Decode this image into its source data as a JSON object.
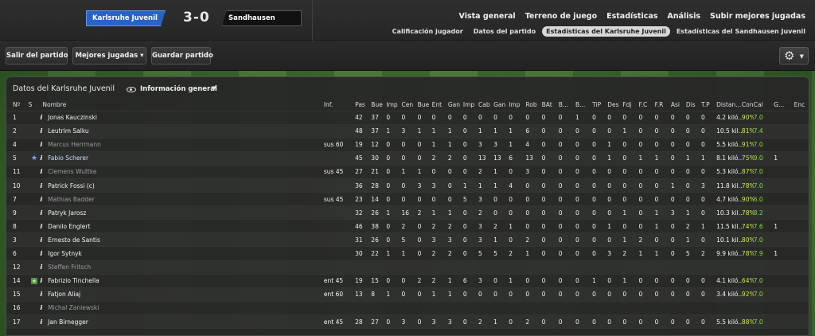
{
  "match": {
    "home_team": "Karlsruhe Juvenil",
    "score": "3-0",
    "away_team": "Sandhausen Juvenil"
  },
  "nav_top": [
    "Vista general",
    "Terreno de juego",
    "Estadísticas",
    "Análisis",
    "Subir mejores jugadas"
  ],
  "nav_sub": [
    {
      "label": "Calificación jugador",
      "active": false
    },
    {
      "label": "Datos del partido",
      "active": false
    },
    {
      "label": "Estadísticas del Karlsruhe Juvenil",
      "active": true
    },
    {
      "label": "Estadísticas del Sandhausen Juvenil",
      "active": false
    }
  ],
  "toolbar": {
    "exit_label": "Salir del partido",
    "highlights_label": "Mejores jugadas",
    "save_label": "Guardar partido"
  },
  "panel": {
    "title": "Datos del Karlsruhe Juvenil",
    "view_label": "Información general"
  },
  "columns": [
    "Nº",
    "S",
    "Nombre",
    "Inf.",
    "Pas",
    "Bue",
    "Imp",
    "Cen",
    "Bue",
    "Ent",
    "Gan",
    "Imp",
    "Cab",
    "Gan",
    "Imp",
    "Rob",
    "BAt",
    "B...",
    "B...",
    "TiP",
    "Des",
    "Fdj",
    "F.C",
    "F.R",
    "Asi",
    "Dis",
    "T.P",
    "Distan...",
    "Con",
    "Cal",
    "G...",
    "Enc"
  ],
  "players": [
    {
      "num": "1",
      "s": "",
      "name": "Jonas Kauczinski",
      "inf": "",
      "stats": [
        "42",
        "37",
        "0",
        "0",
        "0",
        "0",
        "0",
        "0",
        "0",
        "0",
        "0",
        "0",
        "0",
        "0",
        "1",
        "0",
        "0",
        "0",
        "0",
        "0",
        "0",
        "0",
        "0"
      ],
      "dist": "4.2 kiló...",
      "con": "90%",
      "cal": "7.0",
      "g": "",
      "enc": "",
      "type": "normal"
    },
    {
      "num": "2",
      "s": "",
      "name": "Leutrim Salku",
      "inf": "",
      "stats": [
        "48",
        "37",
        "1",
        "3",
        "1",
        "1",
        "1",
        "0",
        "1",
        "1",
        "1",
        "6",
        "0",
        "0",
        "0",
        "0",
        "0",
        "1",
        "0",
        "0",
        "0",
        "0",
        "0"
      ],
      "dist": "10.5 kil...",
      "con": "81%",
      "cal": "7.4",
      "g": "",
      "enc": "",
      "type": "normal"
    },
    {
      "num": "4",
      "s": "",
      "name": "Marcus Herrmann",
      "inf": "sus 60",
      "stats": [
        "19",
        "12",
        "0",
        "0",
        "0",
        "1",
        "1",
        "0",
        "3",
        "3",
        "1",
        "4",
        "0",
        "0",
        "0",
        "0",
        "1",
        "0",
        "0",
        "0",
        "0",
        "0",
        "0"
      ],
      "dist": "5.5 kiló...",
      "con": "91%",
      "cal": "7.0",
      "g": "",
      "enc": "",
      "type": "sub"
    },
    {
      "num": "5",
      "s": "star",
      "name": "Fabio Scherer",
      "inf": "",
      "stats": [
        "45",
        "30",
        "0",
        "0",
        "0",
        "2",
        "2",
        "0",
        "13",
        "13",
        "6",
        "13",
        "0",
        "0",
        "0",
        "0",
        "1",
        "0",
        "1",
        "1",
        "0",
        "1",
        "1"
      ],
      "dist": "8.1 kiló...",
      "con": "75%",
      "cal": "9.0",
      "g": "1",
      "enc": "",
      "type": "sel"
    },
    {
      "num": "11",
      "s": "",
      "name": "Clemens Wuttke",
      "inf": "sus 45",
      "stats": [
        "27",
        "21",
        "0",
        "1",
        "1",
        "0",
        "0",
        "0",
        "2",
        "1",
        "0",
        "3",
        "0",
        "0",
        "0",
        "0",
        "0",
        "0",
        "0",
        "0",
        "0",
        "0",
        "0"
      ],
      "dist": "5.3 kiló...",
      "con": "87%",
      "cal": "7.0",
      "g": "",
      "enc": "",
      "type": "sub"
    },
    {
      "num": "10",
      "s": "",
      "name": "Patrick Fossi (c)",
      "inf": "",
      "stats": [
        "36",
        "28",
        "0",
        "0",
        "3",
        "3",
        "0",
        "1",
        "1",
        "1",
        "4",
        "0",
        "0",
        "0",
        "0",
        "0",
        "0",
        "0",
        "0",
        "0",
        "1",
        "0",
        "3"
      ],
      "dist": "11.8 kil...",
      "con": "78%",
      "cal": "7.0",
      "g": "",
      "enc": "",
      "type": "normal"
    },
    {
      "num": "7",
      "s": "",
      "name": "Mathias Badder",
      "inf": "sus 45",
      "stats": [
        "23",
        "14",
        "0",
        "0",
        "0",
        "0",
        "0",
        "5",
        "3",
        "0",
        "0",
        "0",
        "0",
        "0",
        "0",
        "0",
        "0",
        "0",
        "0",
        "0",
        "0",
        "0",
        "0"
      ],
      "dist": "4.7 kiló...",
      "con": "90%",
      "cal": "6.0",
      "g": "",
      "enc": "",
      "type": "sub"
    },
    {
      "num": "9",
      "s": "",
      "name": "Patryk Jarosz",
      "inf": "",
      "stats": [
        "32",
        "26",
        "1",
        "16",
        "2",
        "1",
        "1",
        "0",
        "2",
        "0",
        "0",
        "0",
        "0",
        "0",
        "0",
        "0",
        "0",
        "1",
        "0",
        "1",
        "3",
        "1",
        "0"
      ],
      "dist": "10.3 kil...",
      "con": "78%",
      "cal": "8.2",
      "g": "",
      "enc": "",
      "type": "normal"
    },
    {
      "num": "8",
      "s": "",
      "name": "Danilo Englert",
      "inf": "",
      "stats": [
        "46",
        "38",
        "0",
        "2",
        "0",
        "2",
        "2",
        "0",
        "3",
        "2",
        "1",
        "0",
        "0",
        "0",
        "0",
        "0",
        "1",
        "0",
        "0",
        "1",
        "0",
        "2",
        "1"
      ],
      "dist": "11.5 kil...",
      "con": "74%",
      "cal": "7.6",
      "g": "1",
      "enc": "",
      "type": "normal"
    },
    {
      "num": "3",
      "s": "",
      "name": "Ernesto de Santis",
      "inf": "",
      "stats": [
        "31",
        "26",
        "0",
        "5",
        "0",
        "3",
        "3",
        "0",
        "3",
        "1",
        "0",
        "2",
        "0",
        "0",
        "0",
        "0",
        "0",
        "1",
        "2",
        "0",
        "0",
        "1",
        "0"
      ],
      "dist": "10.1 kil...",
      "con": "80%",
      "cal": "7.0",
      "g": "",
      "enc": "",
      "type": "normal"
    },
    {
      "num": "6",
      "s": "",
      "name": "Igor Sytnyk",
      "inf": "",
      "stats": [
        "30",
        "22",
        "1",
        "1",
        "0",
        "2",
        "2",
        "0",
        "5",
        "5",
        "2",
        "1",
        "0",
        "0",
        "0",
        "0",
        "3",
        "2",
        "1",
        "1",
        "0",
        "5",
        "2"
      ],
      "dist": "9.9 kiló...",
      "con": "78%",
      "cal": "7.9",
      "g": "1",
      "enc": "",
      "type": "normal"
    },
    {
      "num": "12",
      "s": "",
      "name": "Steffen Fritsch",
      "inf": "",
      "stats": [
        "",
        "",
        "",
        "",
        "",
        "",
        "",
        "",
        "",
        "",
        "",
        "",
        "",
        "",
        "",
        "",
        "",
        "",
        "",
        "",
        "",
        "",
        ""
      ],
      "dist": "",
      "con": "",
      "cal": "",
      "g": "",
      "enc": "",
      "type": "sub"
    },
    {
      "num": "14",
      "s": "plus",
      "name": "Fabrizio Tinchella",
      "inf": "ent 45",
      "stats": [
        "19",
        "15",
        "0",
        "0",
        "2",
        "2",
        "1",
        "6",
        "3",
        "0",
        "1",
        "0",
        "0",
        "0",
        "0",
        "1",
        "0",
        "1",
        "0",
        "0",
        "0",
        "0",
        "0"
      ],
      "dist": "4.1 kiló...",
      "con": "64%",
      "cal": "7.0",
      "g": "",
      "enc": "",
      "type": "normal"
    },
    {
      "num": "15",
      "s": "",
      "name": "Fatjon Aliaj",
      "inf": "ent 60",
      "stats": [
        "13",
        "8",
        "1",
        "0",
        "0",
        "1",
        "1",
        "0",
        "0",
        "0",
        "0",
        "0",
        "0",
        "0",
        "0",
        "0",
        "0",
        "0",
        "0",
        "0",
        "0",
        "0",
        "0"
      ],
      "dist": "3.4 kiló...",
      "con": "92%",
      "cal": "7.0",
      "g": "",
      "enc": "",
      "type": "normal"
    },
    {
      "num": "16",
      "s": "",
      "name": "Michal Zaniewski",
      "inf": "",
      "stats": [
        "",
        "",
        "",
        "",
        "",
        "",
        "",
        "",
        "",
        "",
        "",
        "",
        "",
        "",
        "",
        "",
        "",
        "",
        "",
        "",
        "",
        "",
        ""
      ],
      "dist": "",
      "con": "",
      "cal": "",
      "g": "",
      "enc": "",
      "type": "sub"
    },
    {
      "num": "17",
      "s": "",
      "name": "Jan Birnegger",
      "inf": "ent 45",
      "stats": [
        "28",
        "27",
        "0",
        "3",
        "0",
        "3",
        "3",
        "0",
        "2",
        "1",
        "0",
        "2",
        "0",
        "0",
        "0",
        "0",
        "0",
        "0",
        "0",
        "0",
        "0",
        "0",
        "0"
      ],
      "dist": "5.5 kiló...",
      "con": "88%",
      "cal": "7.0",
      "g": "",
      "enc": "",
      "type": "normal"
    }
  ]
}
